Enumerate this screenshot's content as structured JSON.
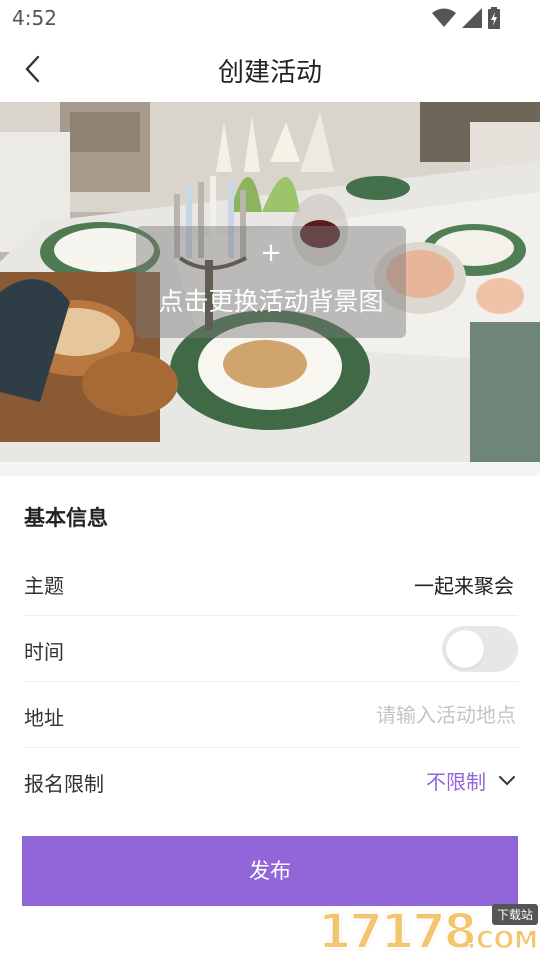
{
  "status_bar": {
    "time": "4:52"
  },
  "header": {
    "title": "创建活动"
  },
  "banner": {
    "plus": "+",
    "change_label": "点击更换活动背景图"
  },
  "basic_info": {
    "title": "基本信息",
    "topic": {
      "label": "主题",
      "value": "一起来聚会"
    },
    "time": {
      "label": "时间",
      "enabled": false
    },
    "address": {
      "label": "地址",
      "placeholder": "请输入活动地点",
      "value": ""
    },
    "signup_limit": {
      "label": "报名限制",
      "value": "不限制"
    }
  },
  "publish": {
    "label": "发布"
  },
  "watermark": {
    "number": "17178",
    "badge": "下载站",
    "suffix": ".COM"
  },
  "colors": {
    "accent": "#9166d8",
    "accent_text": "#9066dd",
    "toggle_off": "#e7e7e7",
    "divider": "#eeeeee"
  },
  "icons": {
    "back": "chevron-left-icon",
    "wifi": "wifi-icon",
    "signal": "signal-icon",
    "battery": "battery-icon",
    "dropdown": "chevron-down-icon"
  }
}
